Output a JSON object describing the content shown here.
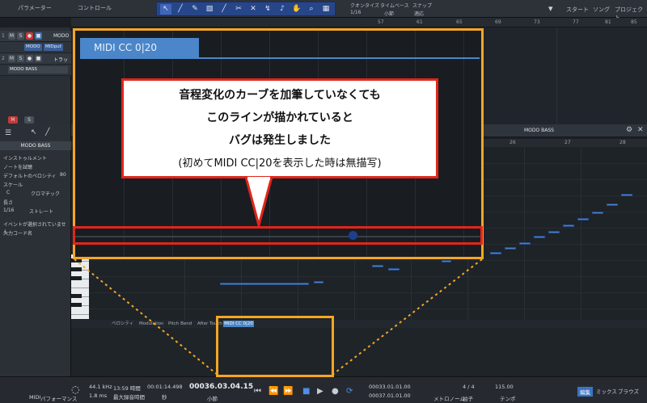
{
  "topbar": {
    "param_label": "パラメーター",
    "control_label": "コントロール",
    "quantize_label": "クオンタイズ",
    "quantize_value": "1/16",
    "timebase_label": "タイムベース",
    "timebase_value": "小節",
    "snap_label": "スナップ",
    "snap_value": "適応",
    "start_label": "スタート",
    "song_label": "ソング",
    "project_label": "プロジェクト"
  },
  "ruler_ticks": [
    "57",
    "61",
    "65",
    "69",
    "73",
    "77",
    "81",
    "85"
  ],
  "tracks": [
    {
      "num": "1",
      "name": "MODO",
      "chip1": "MODO",
      "chip2": "MIDput"
    },
    {
      "num": "2",
      "name": "トラック",
      "chip1": "MODO BASS"
    }
  ],
  "inspector": {
    "title": "MODO BASS",
    "instrument": "インストゥルメント",
    "note_fx": "ノートを試聴",
    "velocity": "デフォルトのベロシティ",
    "velocity_value": "80",
    "scale": "スケール",
    "scale_key": "C",
    "scale_type": "クロマチック",
    "length": "長さ",
    "length_value": "1/16",
    "length_mode": "ストレート",
    "no_event": "イベントが選択されていません",
    "input_code": "入力コード名"
  },
  "editor": {
    "header_title": "MODO BASS",
    "ruler_ticks": [
      "26",
      "27",
      "28"
    ]
  },
  "lanes": {
    "tabs": [
      "ベロシティ",
      "Modulation",
      "Pitch Bend",
      "After Touch",
      "MIDI CC 0|20"
    ],
    "selected_tab": "MIDI CC 0|20"
  },
  "popup": {
    "tab_label": "MIDI CC 0|20"
  },
  "callout": {
    "line1": "音程変化のカーブを加筆していなくても",
    "line2": "このラインが描かれていると",
    "line3": "バグは発生しました",
    "line4": "(初めてMIDI CC|20を表示した時は無描写)"
  },
  "transport": {
    "midi": "MIDI",
    "performance": "パフォーマンス",
    "sample_rate": "44.1 kHz",
    "latency": "1.8 ms",
    "record_time": "13:59 時間",
    "max_record": "最大録音時間",
    "time": "00:01:14.498",
    "time_label": "秒",
    "bars": "00036.03.04.15",
    "bars_label": "小節",
    "loop_start": "00033.01.01.00",
    "loop_end": "00037.01.01.00",
    "metronome": "メトロノーム",
    "timesig": "4 / 4",
    "timesig_label": "拍子",
    "tempo": "115.00",
    "tempo_label": "テンポ",
    "edit_tab": "編集",
    "mix_tab": "ミックス",
    "browse_tab": "ブラウズ"
  },
  "colors": {
    "highlight_orange": "#f5a623",
    "callout_red": "#e0261b",
    "accent_blue": "#4a86c9"
  }
}
